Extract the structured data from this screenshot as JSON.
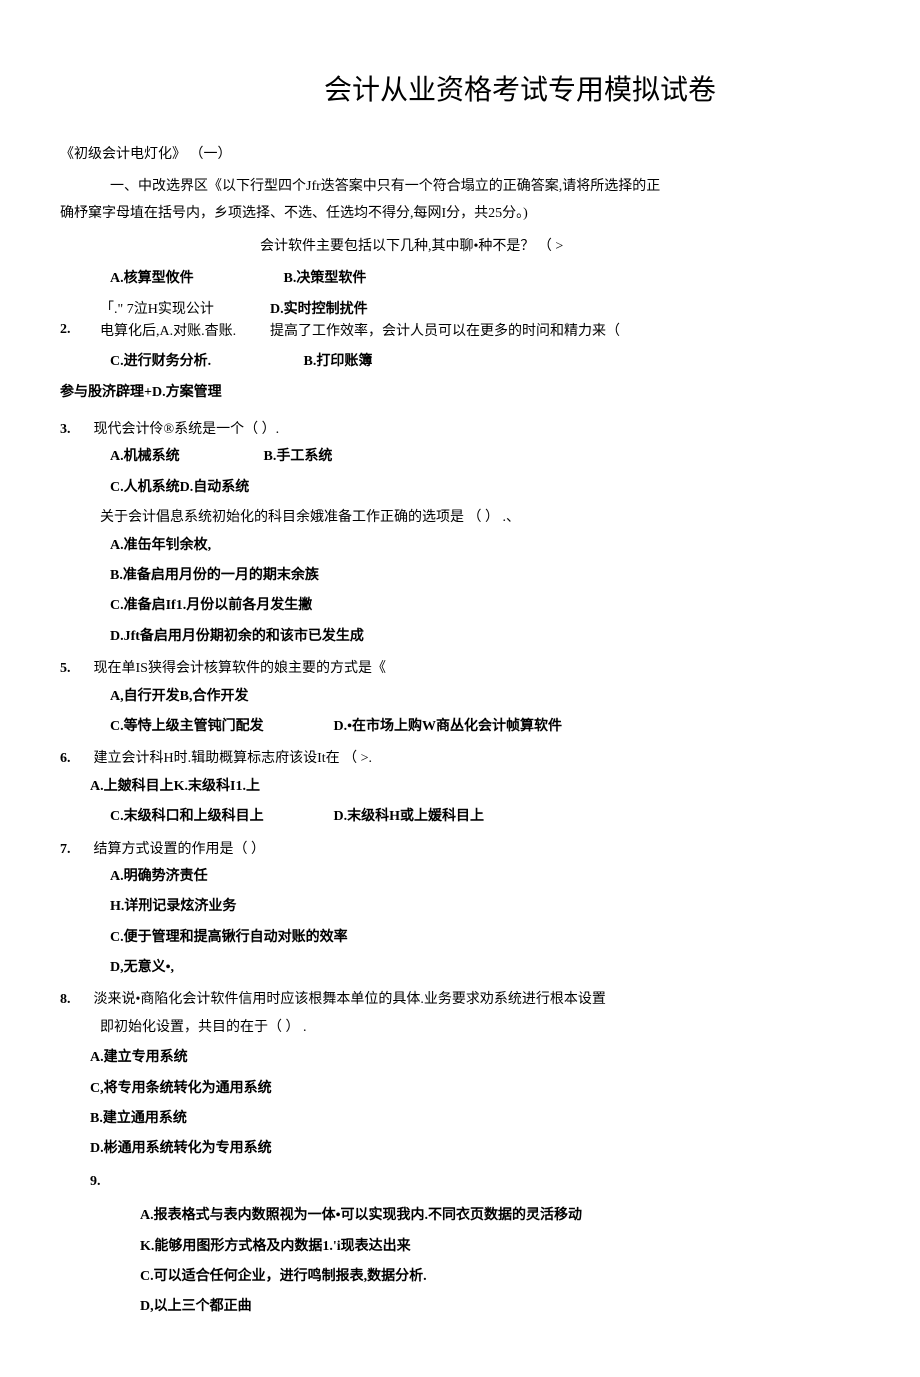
{
  "title": "会计从业资格考试专用模拟试卷",
  "subtitle": "《初级会计电灯化》 （一）",
  "instruction": "一、中改选界区《以下行型四个Jfr迭答案中只有一个符合塌立的正确答案,请将所选择的正",
  "instruction2": "确杼窠字母埴在括号内，乡项选择、不选、任选均不得分,每网I分，共25分。)",
  "q1_line": "会计软件主要包括以下几种,其中聊•种不是？ （      >",
  "q1_a": "A.核算型攸件",
  "q1_b": "B.决策型软件",
  "q1_c": "「.\"  7泣H实现公计",
  "q1_d": "D.实时控制扰件",
  "q2_num": "2.",
  "q2_text1": "电算化后,A.对账.杳账.",
  "q2_text2": "提高了工作效率，会计人员可以在更多的时问和精力来（",
  "q2_c": "C.进行财务分析.",
  "q2_b": "B.打印账簿",
  "q2_extra": "参与股济辟理+D.方案管理",
  "q3_num": "3.",
  "q3_text": "现代会计伶®系统是一个（            ）.",
  "q3_a": "A.机械系统",
  "q3_b": "B.手工系统",
  "q3_c": "C.人机系统D.自动系统",
  "q4_text": "关于会计倡息系统初始化的科目余娥准备工作正确的选项是 （            ） .、",
  "q4_a": "A.准缶年钊余枚,",
  "q4_b": "B.准备启用月份的一月的期末余族",
  "q4_c": "C.准备启If1.月份以前各月发生撇",
  "q4_d": "D.Jft备启用月份期初余的和该市已发生成",
  "q5_num": "5.",
  "q5_text": "现在单IS狭得会计核算软件的娘主要的方式是《",
  "q5_a": "A,自行开发B,合作开发",
  "q5_c": "C.等恃上级主管钝门配发",
  "q5_d": "D.•在市场上购W商丛化会计帧算软件",
  "q6_num": "6.",
  "q6_text": "建立会计科H时.辑助概算标志府该设It在 （                 >.",
  "q6_a": "A.上皴科目上K.末级科I1.上",
  "q6_c": "C.末级科口和上级科目上",
  "q6_d": "D.末级科H或上媛科目上",
  "q7_num": "7.",
  "q7_text": "结算方式设置的作用是（          ）",
  "q7_a": "A.明确势济责任",
  "q7_b": "H.详刑记录炫济业务",
  "q7_c": "C.便于管理和提高锹行自动对账的效率",
  "q7_d": "D,无意义•,",
  "q8_num": "8.",
  "q8_text": "淡来说•商陷化会计软件信用时应该根舞本单位的具体.业务要求劝系统进行根本设置",
  "q8_text2": "即初始化设置，共目的在于（         ） .",
  "q8_a": "A.建立专用系统",
  "q8_c": "C,将专用条统转化为通用系统",
  "q8_b": "B.建立通用系统",
  "q8_d": "D.彬通用系统转化为专用系统",
  "q9_num": "9.",
  "q9_a": "A.报表格式与表内数照视为一体•可以实现我内.不同衣页数据的灵活移动",
  "q9_k": "K.能够用图形方式格及内数据1.'i现表达出来",
  "q9_c": "C.可以适合任何企业，进行鸣制报表,数据分析.",
  "q9_d": "D,以上三个都正曲"
}
